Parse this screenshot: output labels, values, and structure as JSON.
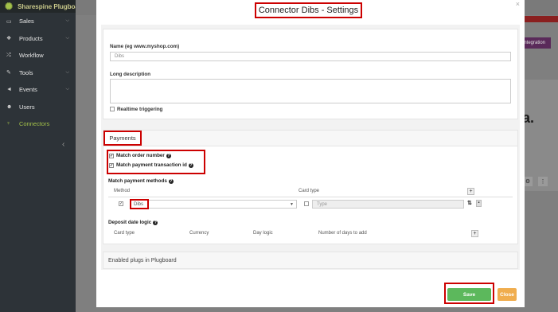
{
  "app": {
    "brand": "Sharespine Plugboard I"
  },
  "sidebar": {
    "items": [
      {
        "label": "Sales",
        "icon": "money-icon",
        "has_submenu": true,
        "active": false
      },
      {
        "label": "Products",
        "icon": "cubes-icon",
        "has_submenu": true,
        "active": false
      },
      {
        "label": "Workflow",
        "icon": "shuffle-icon",
        "has_submenu": false,
        "active": false
      },
      {
        "label": "Tools",
        "icon": "wrench-icon",
        "has_submenu": true,
        "active": false
      },
      {
        "label": "Events",
        "icon": "bullhorn-icon",
        "has_submenu": true,
        "active": false
      },
      {
        "label": "Users",
        "icon": "users-icon",
        "has_submenu": false,
        "active": false
      },
      {
        "label": "Connectors",
        "icon": "plug-icon",
        "has_submenu": false,
        "active": true
      }
    ]
  },
  "background": {
    "integration_label": "integration",
    "letter": "a."
  },
  "modal": {
    "title": "Connector Dibs - Settings",
    "name_label": "Name (eg www.myshop.com)",
    "name_value": "Dibs",
    "long_description_label": "Long description",
    "long_description_value": "",
    "realtime_label": "Realtime triggering",
    "realtime_checked": false,
    "payments": {
      "header": "Payments",
      "match_order_number": "Match order number",
      "match_order_number_checked": true,
      "match_payment_transaction": "Match payment transaction id",
      "match_payment_transaction_checked": true,
      "match_methods_label": "Match payment methods",
      "col_method": "Method",
      "col_card_type": "Card type",
      "row": {
        "enabled": true,
        "method": "Dibs",
        "card_type_checked": false,
        "card_type_placeholder": "Type"
      },
      "deposit_label": "Deposit date logic",
      "deposit_columns": [
        "Card type",
        "Currency",
        "Day logic",
        "Number of days to add"
      ]
    },
    "enabled_plugs": "Enabled plugs in Plugboard",
    "save_label": "Save",
    "close_label": "Close"
  },
  "colors": {
    "highlight": "#cc0000",
    "save": "#5cb85c",
    "close": "#f0ad4e",
    "sidebar_active": "#a3c14a"
  }
}
